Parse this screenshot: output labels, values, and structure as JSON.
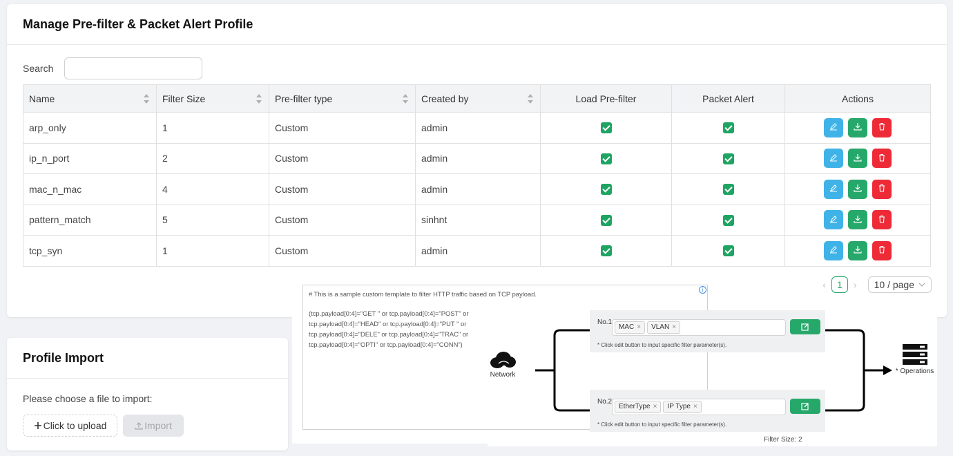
{
  "manage": {
    "title": "Manage Pre-filter & Packet Alert Profile",
    "search_label": "Search",
    "search_value": "",
    "columns": [
      "Name",
      "Filter Size",
      "Pre-filter type",
      "Created by",
      "Load Pre-filter",
      "Packet Alert",
      "Actions"
    ],
    "rows": [
      {
        "name": "arp_only",
        "size": "1",
        "type": "Custom",
        "by": "admin",
        "load": true,
        "alert": true
      },
      {
        "name": "ip_n_port",
        "size": "2",
        "type": "Custom",
        "by": "admin",
        "load": true,
        "alert": true
      },
      {
        "name": "mac_n_mac",
        "size": "4",
        "type": "Custom",
        "by": "admin",
        "load": true,
        "alert": true
      },
      {
        "name": "pattern_match",
        "size": "5",
        "type": "Custom",
        "by": "sinhnt",
        "load": true,
        "alert": true
      },
      {
        "name": "tcp_syn",
        "size": "1",
        "type": "Custom",
        "by": "admin",
        "load": true,
        "alert": true
      }
    ],
    "pagination": {
      "current_page": "1",
      "page_size": "10 / page"
    }
  },
  "import": {
    "title": "Profile Import",
    "prompt": "Please choose a file to import:",
    "upload_label": "Click to upload",
    "import_label": "Import"
  },
  "template": {
    "line1": "# This is a sample custom template to filter HTTP traffic based on TCP payload.",
    "line2": "(tcp.payload[0:4]=\"GET \" or tcp.payload[0:4]=\"POST\" or",
    "line3": "tcp.payload[0:4]=\"HEAD\" or tcp.payload[0:4]=\"PUT \" or",
    "line4": "tcp.payload[0:4]=\"DELE\" or tcp.payload[0:4]=\"TRAC\" or",
    "line5": "tcp.payload[0:4]=\"OPTI\" or tcp.payload[0:4]=\"CONN\")"
  },
  "diagram": {
    "network_label": "Network",
    "operations_label": "* Operations",
    "filters": [
      {
        "no": "No.1",
        "tags": [
          "MAC",
          "VLAN"
        ],
        "hint": "* Click edit button to input specific filter parameter(s)."
      },
      {
        "no": "No.2",
        "tags": [
          "EtherType",
          "IP Type"
        ],
        "hint": "* Click edit button to input specific filter parameter(s)."
      }
    ],
    "filter_size": "Filter Size: 2"
  },
  "colors": {
    "accent": "#27a86b",
    "edit": "#3fb3e8",
    "delete": "#ee2a37",
    "disabled_bg": "#e4e6ea"
  },
  "icons": [
    "sort-icon",
    "checkbox-checked-icon",
    "edit-icon",
    "download-icon",
    "trash-icon",
    "plus-icon",
    "upload-icon",
    "info-icon",
    "cloud-network-icon",
    "server-icon",
    "chevron-left-icon",
    "chevron-right-icon",
    "chevron-down-icon",
    "close-icon"
  ]
}
